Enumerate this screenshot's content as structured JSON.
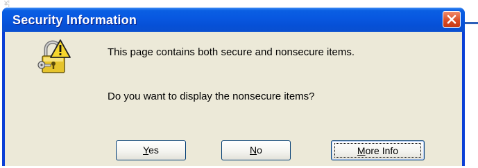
{
  "dialog": {
    "title": "Security Information",
    "message": "This page contains both secure and nonsecure items.",
    "question": "Do you want to display the nonsecure items?",
    "buttons": {
      "yes": {
        "mnemonic": "Y",
        "rest": "es"
      },
      "no": {
        "mnemonic": "N",
        "rest": "o"
      },
      "more_info": {
        "mnemonic": "M",
        "rest": "ore Info"
      }
    }
  },
  "background": {
    "stray_text": "¥¦"
  },
  "colors": {
    "title_bar": "#0857e0",
    "client_bg": "#ece9d8",
    "close_button": "#d94a23",
    "warning_yellow": "#f6d62c"
  },
  "icons": {
    "close": "close-icon",
    "security_warning": "lock-warning-icon"
  }
}
